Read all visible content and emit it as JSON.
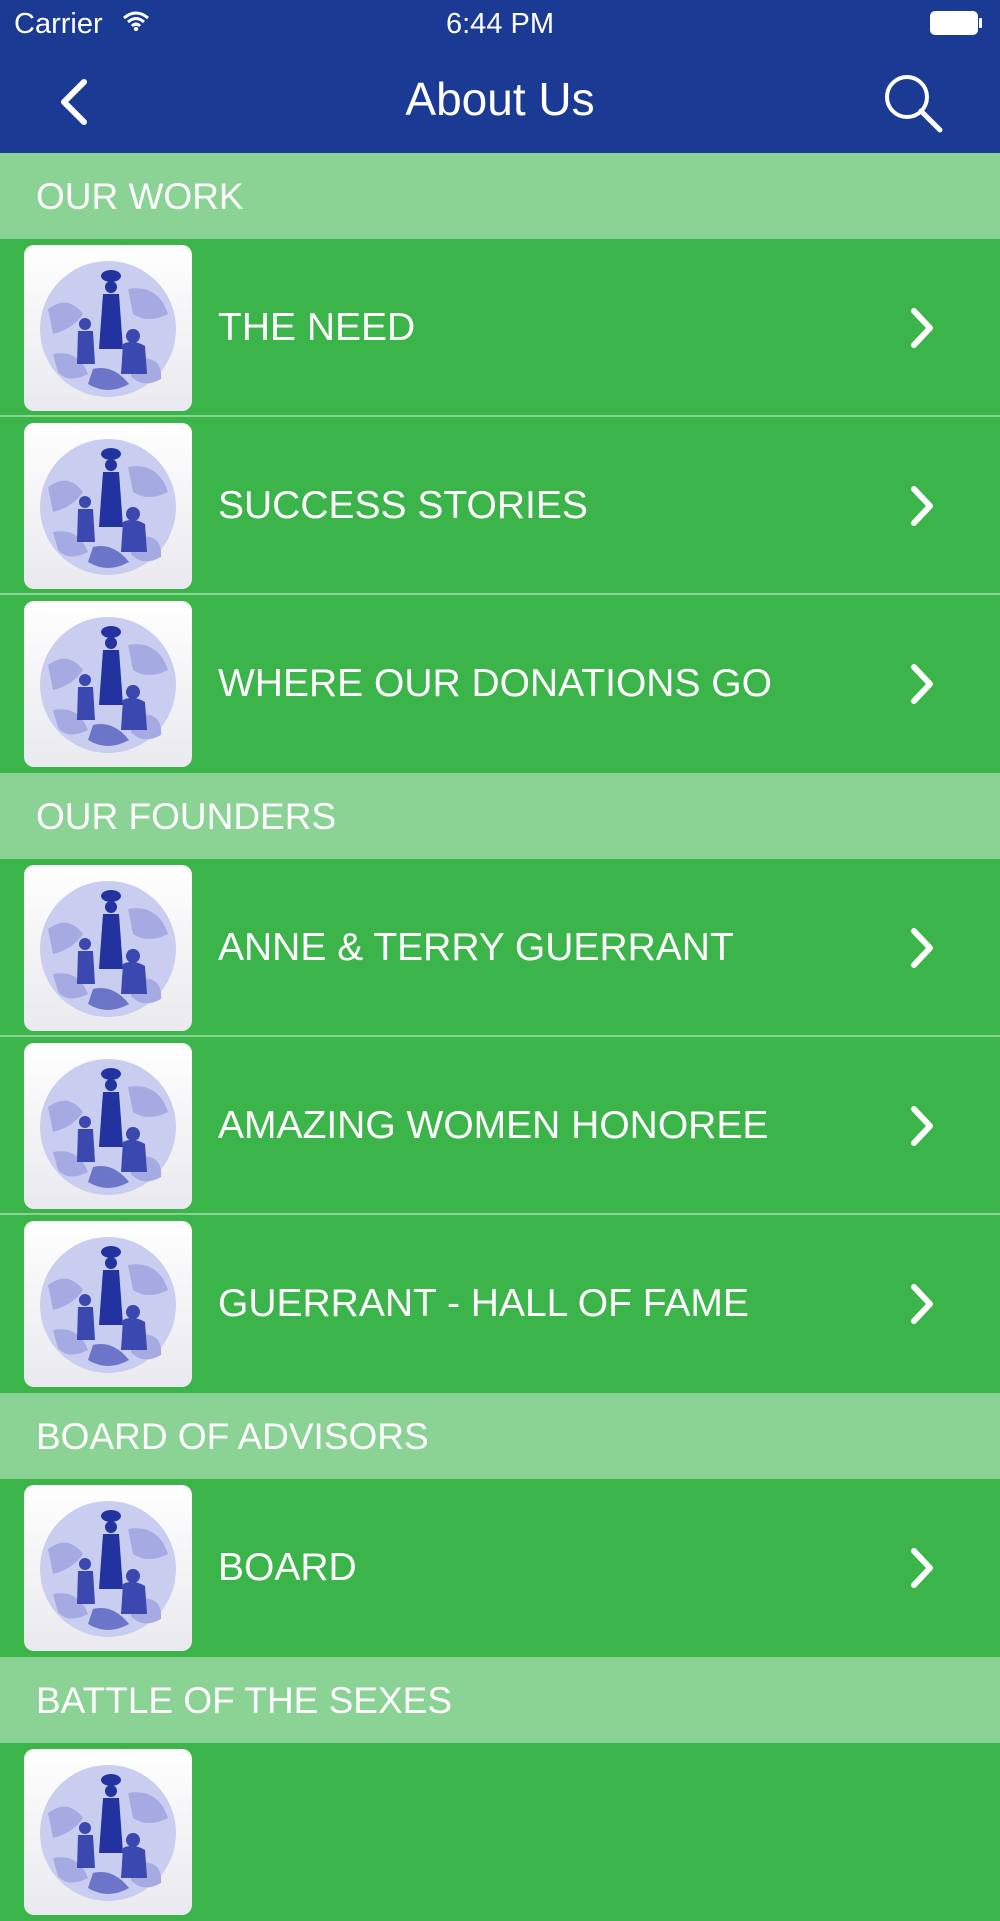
{
  "status_bar": {
    "carrier": "Carrier",
    "time": "6:44 PM"
  },
  "nav": {
    "title": "About Us",
    "back_icon": "chevron-left-icon",
    "search_icon": "search-icon"
  },
  "colors": {
    "nav_background": "#1b3a93",
    "section_background": "#8bd394",
    "row_background": "#3bb54a",
    "text": "#ffffff"
  },
  "sections": [
    {
      "title": "OUR WORK",
      "items": [
        {
          "label": "THE NEED"
        },
        {
          "label": "SUCCESS STORIES"
        },
        {
          "label": "WHERE OUR DONATIONS GO"
        }
      ]
    },
    {
      "title": "OUR FOUNDERS",
      "items": [
        {
          "label": "ANNE & TERRY GUERRANT"
        },
        {
          "label": "AMAZING WOMEN HONOREE"
        },
        {
          "label": "GUERRANT - HALL OF FAME"
        }
      ]
    },
    {
      "title": "BOARD OF ADVISORS",
      "items": [
        {
          "label": "BOARD"
        }
      ]
    },
    {
      "title": "BATTLE OF THE SEXES",
      "items": [
        {
          "label": ""
        }
      ]
    }
  ]
}
